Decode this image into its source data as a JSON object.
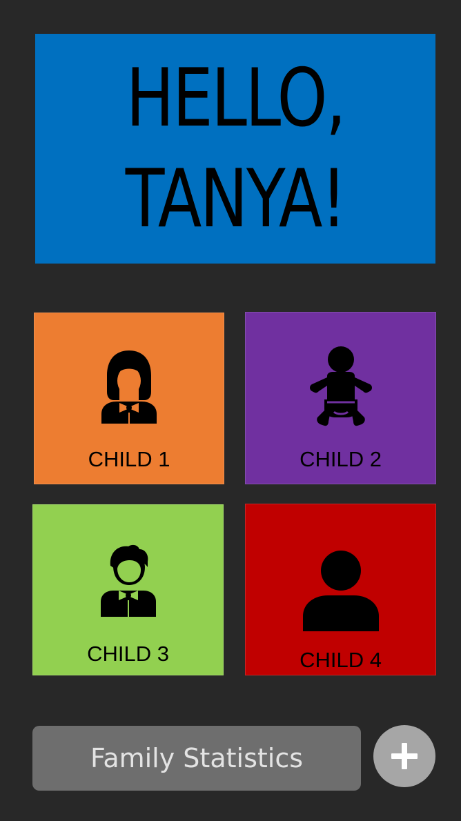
{
  "greeting": {
    "line1": "HELLO,",
    "line2": "TANYA!",
    "color": "#0070C0"
  },
  "children": [
    {
      "label": "CHILD 1",
      "icon": "girl-icon",
      "color": "#ED7D31"
    },
    {
      "label": "CHILD 2",
      "icon": "baby-icon",
      "color": "#7030A0"
    },
    {
      "label": "CHILD 3",
      "icon": "boy-icon",
      "color": "#92D050"
    },
    {
      "label": "CHILD 4",
      "icon": "person-icon",
      "color": "#C00000"
    }
  ],
  "footer": {
    "stats_label": "Family Statistics",
    "add_icon": "plus-icon"
  }
}
